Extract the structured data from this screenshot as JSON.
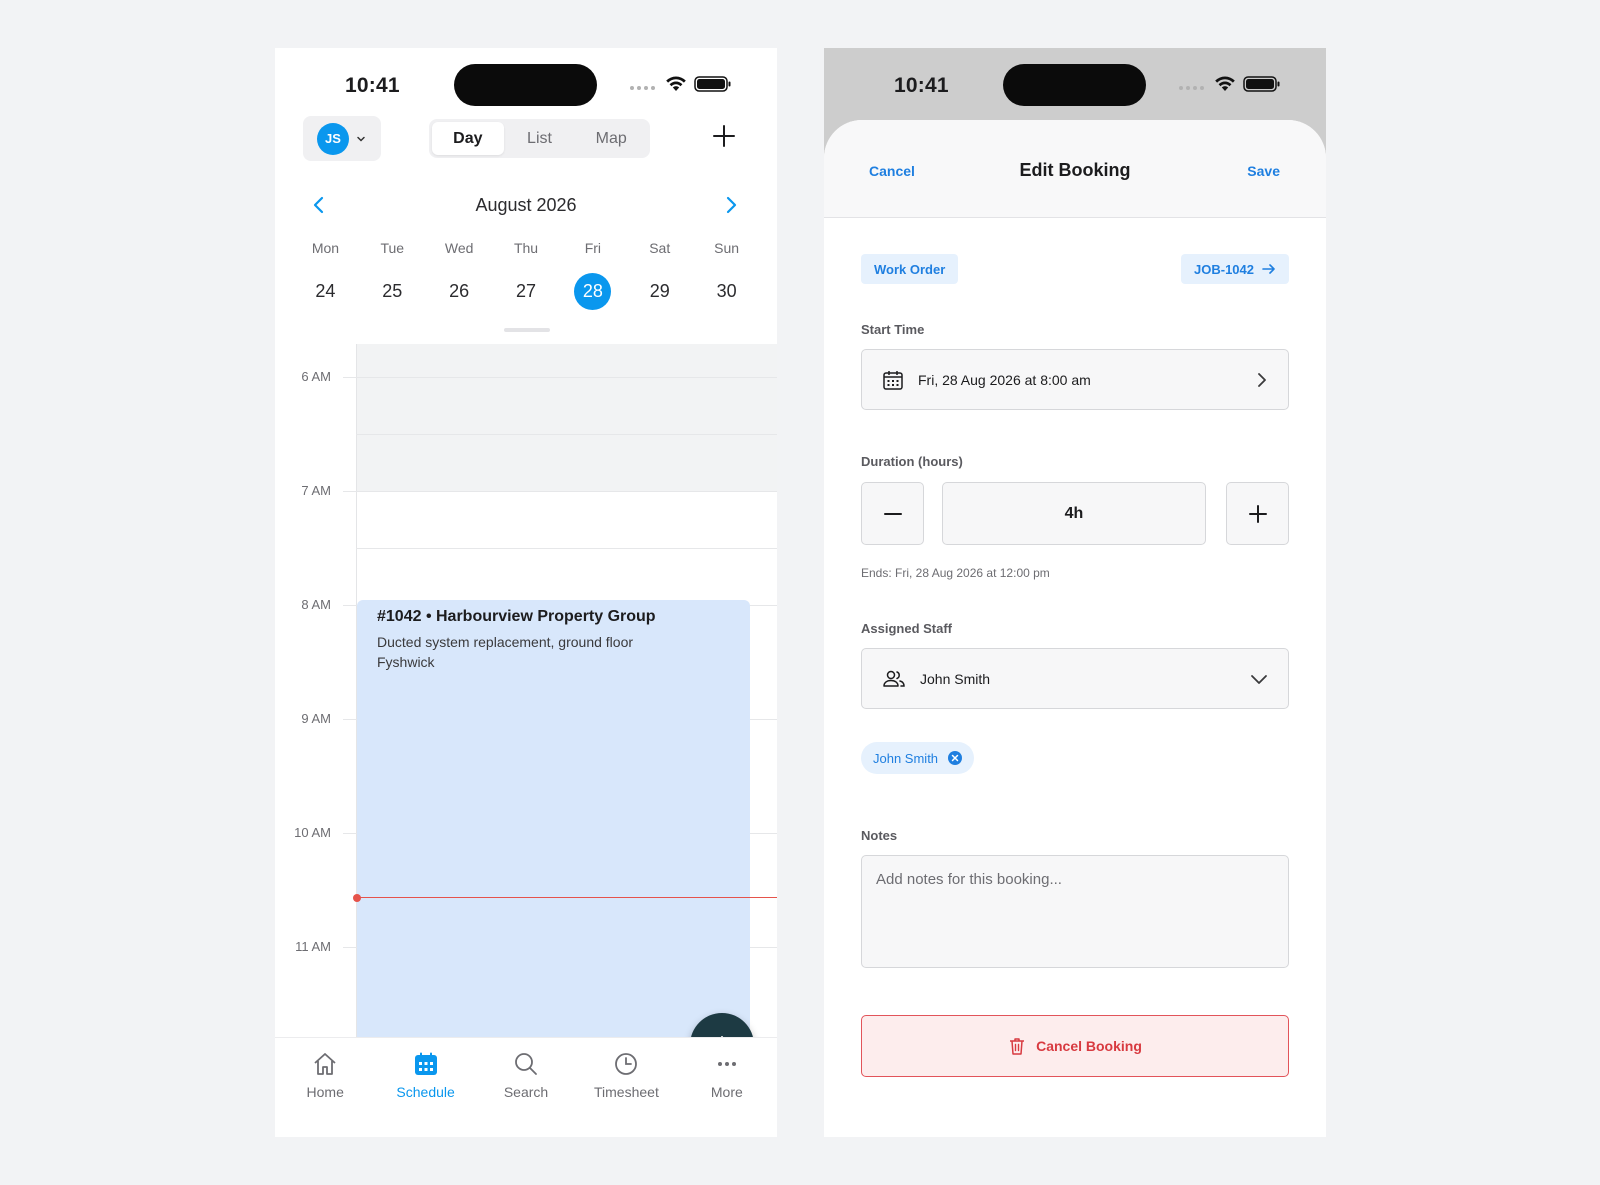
{
  "status_bar": {
    "time": "10:41"
  },
  "schedule": {
    "user_initials": "JS",
    "view_tabs": [
      "Day",
      "List",
      "Map"
    ],
    "active_view": "Day",
    "month_title": "August 2026",
    "weekdays": [
      "Mon",
      "Tue",
      "Wed",
      "Thu",
      "Fri",
      "Sat",
      "Sun"
    ],
    "dates": [
      "24",
      "25",
      "26",
      "27",
      "28",
      "29",
      "30"
    ],
    "selected_date": "28",
    "hours": [
      "6 AM",
      "7 AM",
      "8 AM",
      "9 AM",
      "10 AM",
      "11 AM"
    ],
    "event": {
      "title": "#1042 • Harbourview Property Group",
      "description": "Ducted system replacement, ground floor",
      "location": "Fyshwick"
    },
    "tabbar": [
      {
        "label": "Home",
        "icon": "home-icon"
      },
      {
        "label": "Schedule",
        "icon": "calendar-icon"
      },
      {
        "label": "Search",
        "icon": "search-icon"
      },
      {
        "label": "Timesheet",
        "icon": "clock-icon"
      },
      {
        "label": "More",
        "icon": "more-icon"
      }
    ],
    "active_tab": "Schedule"
  },
  "edit_booking": {
    "cancel_label": "Cancel",
    "title": "Edit Booking",
    "save_label": "Save",
    "type_chip": "Work Order",
    "job_chip": "JOB-1042",
    "start_time_label": "Start Time",
    "start_time_value": "Fri, 28 Aug 2026 at 8:00 am",
    "duration_label": "Duration (hours)",
    "duration_value": "4h",
    "ends_text": "Ends: Fri, 28 Aug 2026 at 12:00 pm",
    "assigned_label": "Assigned Staff",
    "assigned_value": "John Smith",
    "assigned_tag": "John Smith",
    "notes_label": "Notes",
    "notes_placeholder": "Add notes for this booking...",
    "cancel_booking_label": "Cancel Booking"
  },
  "colors": {
    "accent": "#0a97ee",
    "link": "#1f7fe0",
    "event_bg": "#d8e7fb",
    "now_line": "#e5534b",
    "danger": "#d83a40"
  }
}
